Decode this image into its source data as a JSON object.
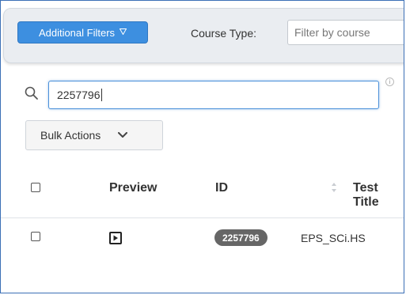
{
  "filters": {
    "additional_filters_label": "Additional Filters",
    "course_type_label": "Course Type:",
    "course_type_placeholder": "Filter by course"
  },
  "search": {
    "value": "2257796",
    "info_glyph": "i"
  },
  "bulk_actions": {
    "label": "Bulk Actions"
  },
  "table": {
    "columns": {
      "preview": "Preview",
      "id": "ID",
      "test_title": "Test Title"
    },
    "rows": [
      {
        "id": "2257796",
        "test_title": "EPS_SCi.HS"
      }
    ]
  },
  "colors": {
    "accent": "#3d8fe0",
    "badge": "#666666",
    "filter_bar": "#eaedf1"
  },
  "icons": [
    "filter-triangle-icon",
    "search-icon",
    "info-icon",
    "chevron-down-icon",
    "sort-icon",
    "preview-play-icon"
  ]
}
